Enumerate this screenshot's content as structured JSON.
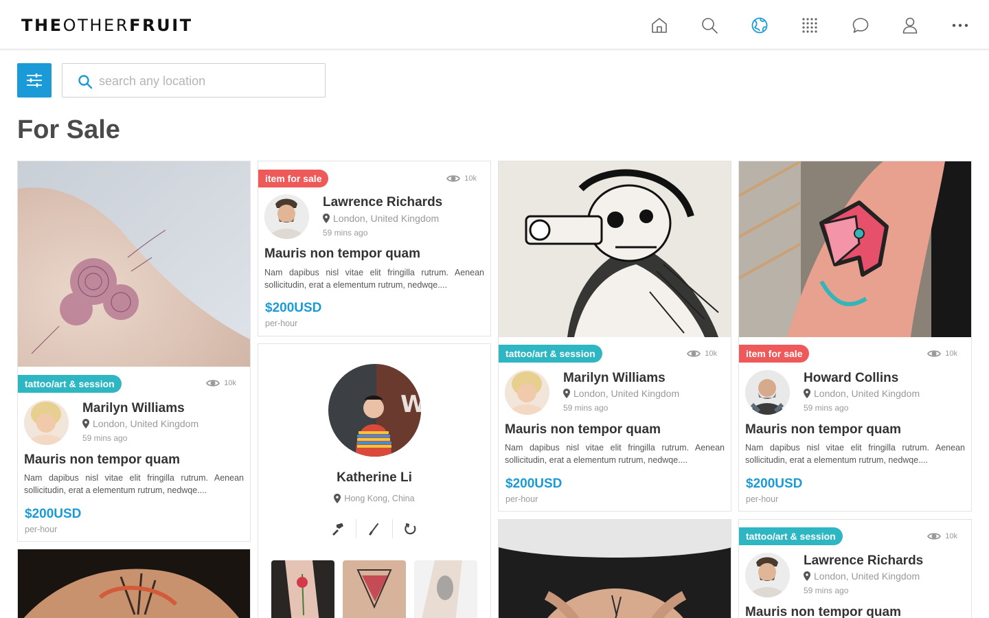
{
  "brand": {
    "bold1": "THE",
    "light": "OTHER",
    "bold2": "FRUIT"
  },
  "nav": [
    "home-icon",
    "search-icon",
    "globe-icon",
    "grid-icon",
    "chat-icon",
    "user-icon",
    "more-icon"
  ],
  "colors": {
    "accent": "#1a9bd7",
    "teal_badge": "#2fb6c3",
    "red_badge": "#ee5a5a",
    "active_nav": "#1a9bd7"
  },
  "search": {
    "placeholder": "search any location"
  },
  "page_title": "For Sale",
  "cards": [
    {
      "badge": "tattoo/art & session",
      "views": "10k",
      "name": "Marilyn Williams",
      "location": "London, United Kingdom",
      "time": "59 mins ago",
      "title": "Mauris non tempor quam",
      "desc": "Nam dapibus nisl vitae elit fringilla rutrum. Aenean sollicitudin, erat a elementum rutrum, nedwqe....",
      "price": "$200USD",
      "unit": "per-hour"
    },
    {
      "badge": "item for sale",
      "views": "10k",
      "name": "Lawrence Richards",
      "location": "London, United Kingdom",
      "time": "59 mins ago",
      "title": "Mauris non tempor quam",
      "desc": "Nam dapibus nisl vitae elit fringilla rutrum. Aenean sollicitudin, erat a elementum rutrum, nedwqe....",
      "price": "$200USD",
      "unit": "per-hour"
    },
    {
      "badge": "tattoo/art & session",
      "views": "10k",
      "name": "Marilyn Williams",
      "location": "London, United Kingdom",
      "time": "59 mins ago",
      "title": "Mauris non tempor quam",
      "desc": "Nam dapibus nisl vitae elit fringilla rutrum. Aenean sollicitudin, erat a elementum rutrum, nedwqe....",
      "price": "$200USD",
      "unit": "per-hour"
    },
    {
      "badge": "item for sale",
      "views": "10k",
      "name": "Howard Collins",
      "location": "London, United Kingdom",
      "time": "59 mins ago",
      "title": "Mauris non tempor quam",
      "desc": "Nam dapibus nisl vitae elit fringilla rutrum. Aenean sollicitudin, erat a elementum rutrum, nedwqe....",
      "price": "$200USD",
      "unit": "per-hour"
    },
    {
      "badge": "tattoo/art & session",
      "views": "10k",
      "name": "Lawrence Richards",
      "location": "London, United Kingdom",
      "time": "59 mins ago",
      "title": "Mauris non tempor quam"
    }
  ],
  "profile": {
    "name": "Katherine Li",
    "location": "Hong Kong, China",
    "tools": [
      "tattoo-machine-icon",
      "brush-icon",
      "refresh-icon"
    ]
  }
}
